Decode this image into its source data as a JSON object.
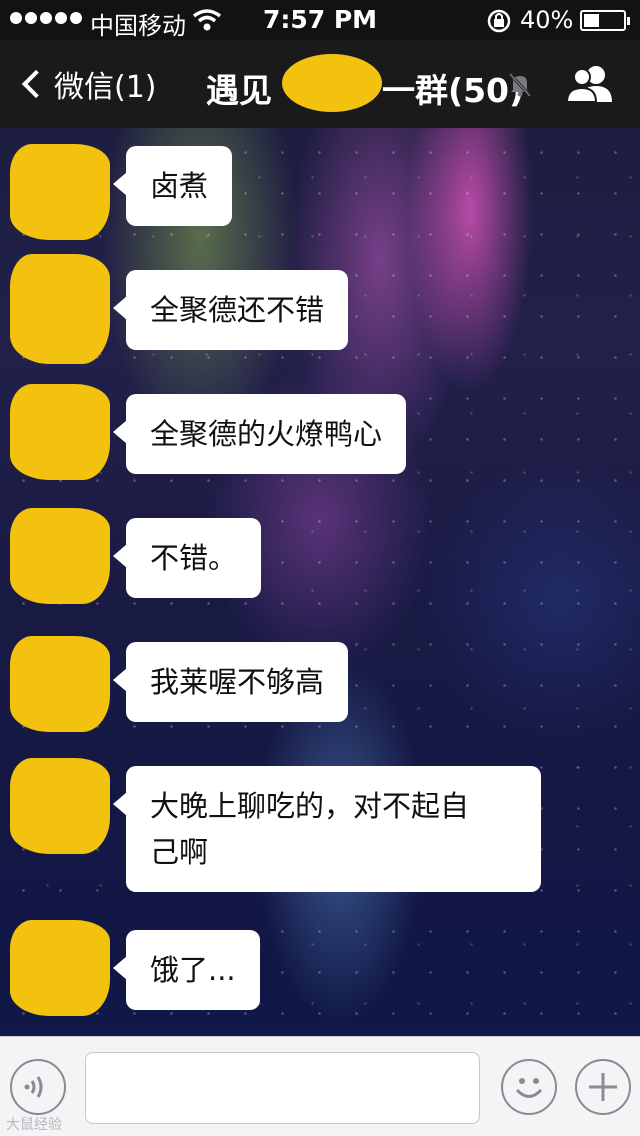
{
  "status_bar": {
    "carrier": "中国移动",
    "time": "7:57 PM",
    "battery_text": "40%",
    "battery_level": 0.4,
    "signal_dots": 5
  },
  "nav": {
    "back_label": "微信(1)",
    "title_prefix": "遇见",
    "title_suffix": "一群(50)"
  },
  "messages": [
    {
      "text": "卤煮"
    },
    {
      "text": "全聚德还不错"
    },
    {
      "text": "全聚德的火燎鸭心"
    },
    {
      "text": "不错。"
    },
    {
      "text": "我莱喔不够高"
    },
    {
      "text": "大晚上聊吃的，对不起自\n己啊"
    },
    {
      "text": "饿了..."
    }
  ],
  "input_bar": {
    "input_value": "",
    "icons": [
      "voice-icon",
      "emoji-icon",
      "plus-icon"
    ]
  },
  "watermark": "大鼠经验",
  "colors": {
    "redaction": "#f3c20f",
    "nav_background": "#1a1a1c",
    "bubble": "#ffffff"
  }
}
